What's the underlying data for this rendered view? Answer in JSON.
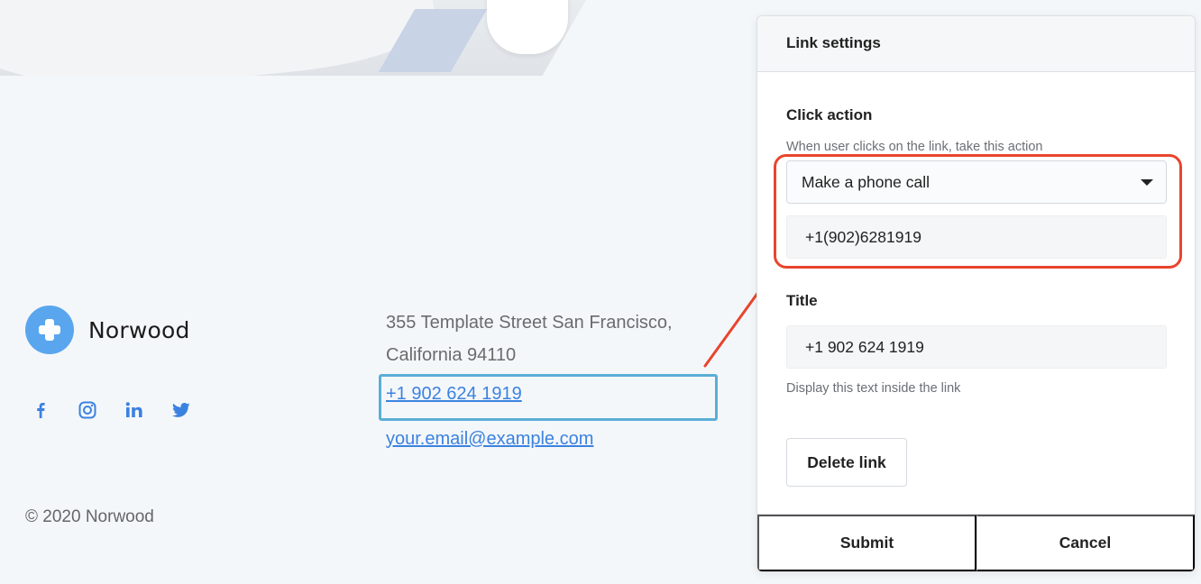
{
  "colors": {
    "accent": "#3b82e0",
    "logo": "#5aa6ee",
    "annotation": "#e8452c",
    "selection": "#5aaed6"
  },
  "footer": {
    "brand": {
      "name": "Norwood",
      "logo_icon": "plus-cross-icon"
    },
    "social": [
      {
        "name": "facebook-icon",
        "glyph": "f"
      },
      {
        "name": "instagram-icon",
        "glyph": "◎"
      },
      {
        "name": "linkedin-icon",
        "glyph": "in"
      },
      {
        "name": "twitter-icon",
        "glyph": "🐦"
      }
    ],
    "address_line1": "355 Template Street San Francisco,",
    "address_line2": "California 94110",
    "phone": "+1 902 624 1919",
    "email": "your.email@example.com",
    "copyright": "© 2020 Norwood"
  },
  "panel": {
    "title": "Link settings",
    "click_action": {
      "label": "Click action",
      "hint": "When user clicks on the link, take this action",
      "selected": "Make a phone call",
      "phone_value": "+1(902)6281919"
    },
    "title_field": {
      "label": "Title",
      "value": "+1 902 624 1919",
      "hint": "Display this text inside the link"
    },
    "delete_label": "Delete link",
    "submit_label": "Submit",
    "cancel_label": "Cancel"
  }
}
